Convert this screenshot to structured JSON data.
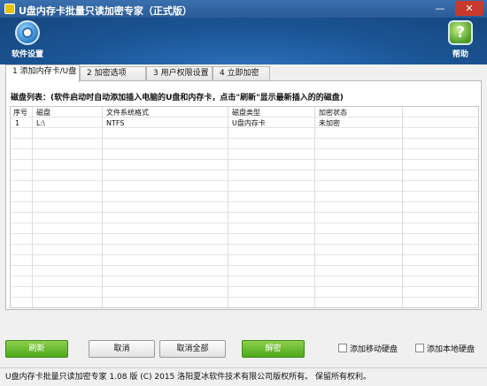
{
  "window": {
    "title": "U盘内存卡批量只读加密专家（正式版）",
    "minimize_glyph": "—",
    "close_glyph": "✕"
  },
  "toolbar": {
    "settings_label": "软件设置",
    "help_label": "帮助",
    "help_glyph": "?"
  },
  "tabs": [
    {
      "label": "1 添加内存卡/U盘",
      "active": true
    },
    {
      "label": "2 加密选项",
      "active": false
    },
    {
      "label": "3 用户权限设置",
      "active": false
    },
    {
      "label": "4 立即加密",
      "active": false
    }
  ],
  "panel": {
    "info": "磁盘列表：(软件启动时自动添加插入电脑的U盘和内存卡，点击\"刷新\"显示最新插入的的磁盘)"
  },
  "table": {
    "columns": [
      "序号",
      "磁盘",
      "文件系统格式",
      "磁盘类型",
      "加密状态"
    ],
    "rows": [
      [
        "1",
        "L:\\",
        "NTFS",
        "U盘内存卡",
        "未加密"
      ]
    ]
  },
  "buttons": {
    "refresh": "刷新",
    "cancel": "取消",
    "cancel_all": "取消全部",
    "decrypt": "解密"
  },
  "checkboxes": {
    "add_mobile_disk": "添加移动硬盘",
    "add_local_disk": "添加本地硬盘"
  },
  "status": {
    "text": "U盘内存卡批量只读加密专家 1.08 版  (C) 2015 洛阳夏冰软件技术有限公司版权所有。 保留所有权利。"
  },
  "colors": {
    "accent_green": "#5cb82a",
    "title_blue": "#2a5c98",
    "close_red": "#c7392c"
  }
}
